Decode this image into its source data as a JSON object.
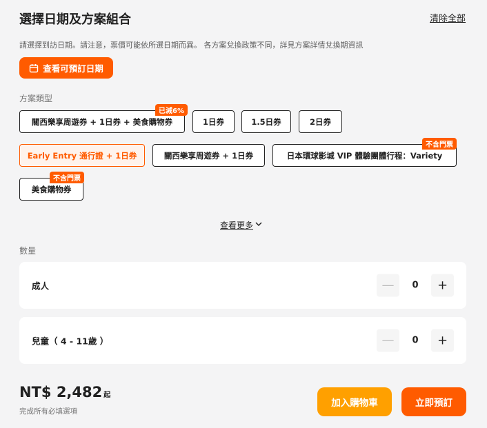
{
  "header": {
    "title": "選擇日期及方案組合",
    "clear_all": "清除全部"
  },
  "notice": "請選擇到訪日期。請注意，票價可能依所選日期而異。 各方案兌換政策不同，詳見方案詳情兌換期資訊",
  "dates_button": {
    "label": "查看可預訂日期",
    "icon": "calendar-icon"
  },
  "package_type": {
    "label": "方案類型",
    "options": [
      {
        "label": "關西樂享周遊券 + 1日券 + 美食購物券",
        "tag": "已減6%",
        "selected": false
      },
      {
        "label": "1日券",
        "selected": false
      },
      {
        "label": "1.5日券",
        "selected": false
      },
      {
        "label": "2日券",
        "selected": false
      },
      {
        "label": "Early Entry 通行證 + 1日券",
        "selected": true
      },
      {
        "label": "關西樂享周遊券 + 1日券",
        "selected": false
      },
      {
        "label": "日本環球影城 VIP 體驗團體行程：Variety",
        "tag": "不含門票",
        "selected": false
      },
      {
        "label": "美食購物券",
        "tag": "不含門票",
        "selected": false
      }
    ],
    "see_more": "查看更多"
  },
  "quantity": {
    "label": "數量",
    "rows": [
      {
        "label": "成人",
        "value": "0"
      },
      {
        "label": "兒童（ 4 - 11歲 ）",
        "value": "0"
      }
    ]
  },
  "footer": {
    "price": "NT$ 2,482",
    "price_suffix": "起",
    "note": "完成所有必填選項",
    "add_to_cart": "加入購物車",
    "book_now": "立即預訂"
  },
  "colors": {
    "accent": "#ff5b00",
    "cart": "#ffa000",
    "background": "#f4f4f5"
  }
}
